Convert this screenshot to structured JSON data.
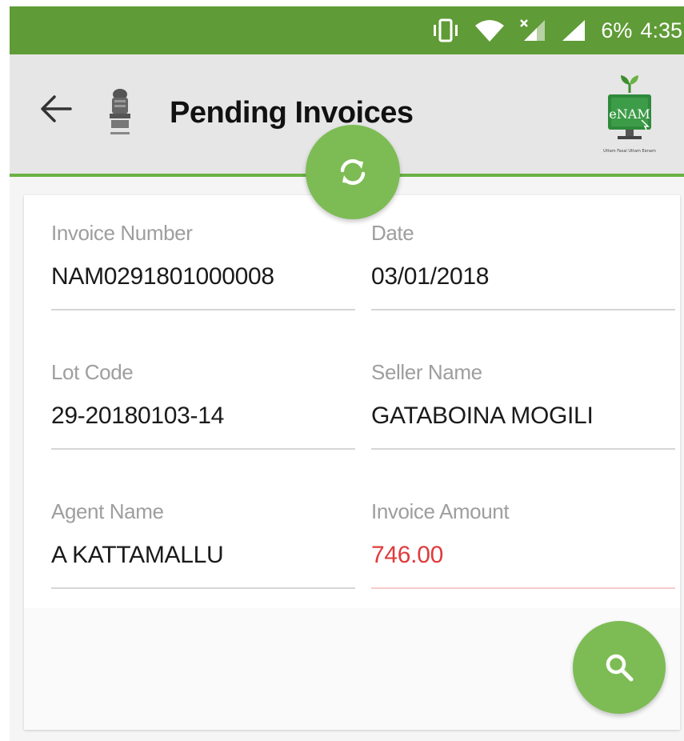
{
  "status_bar": {
    "battery_text": "6%",
    "time": "4:35",
    "icons": [
      "vibrate-icon",
      "wifi-icon",
      "signal-icon",
      "cell-signal-icon"
    ]
  },
  "app_bar": {
    "title": "Pending Invoices",
    "back_icon": "arrow-left-icon",
    "emblem_logo": "national-emblem-logo",
    "brand_logo_text": "eNAM",
    "brand_tagline": "Uttam Fasal Uttam Eenam"
  },
  "refresh_button": {
    "icon": "refresh-icon"
  },
  "search_button": {
    "icon": "search-icon"
  },
  "invoice": {
    "fields": [
      {
        "label": "Invoice Number",
        "value": "NAM0291801000008"
      },
      {
        "label": "Date",
        "value": "03/01/2018"
      },
      {
        "label": "Lot Code",
        "value": "29-20180103-14"
      },
      {
        "label": "Seller Name",
        "value": "GATABOINA MOGILI"
      },
      {
        "label": "Agent Name",
        "value": "A KATTAMALLU"
      },
      {
        "label": "Invoice Amount",
        "value": "746.00"
      }
    ]
  },
  "colors": {
    "status_bar": "#5f9b36",
    "app_bar": "#e6e6e6",
    "accent_green": "#7dbc55",
    "amount_red": "#e03b3b"
  }
}
